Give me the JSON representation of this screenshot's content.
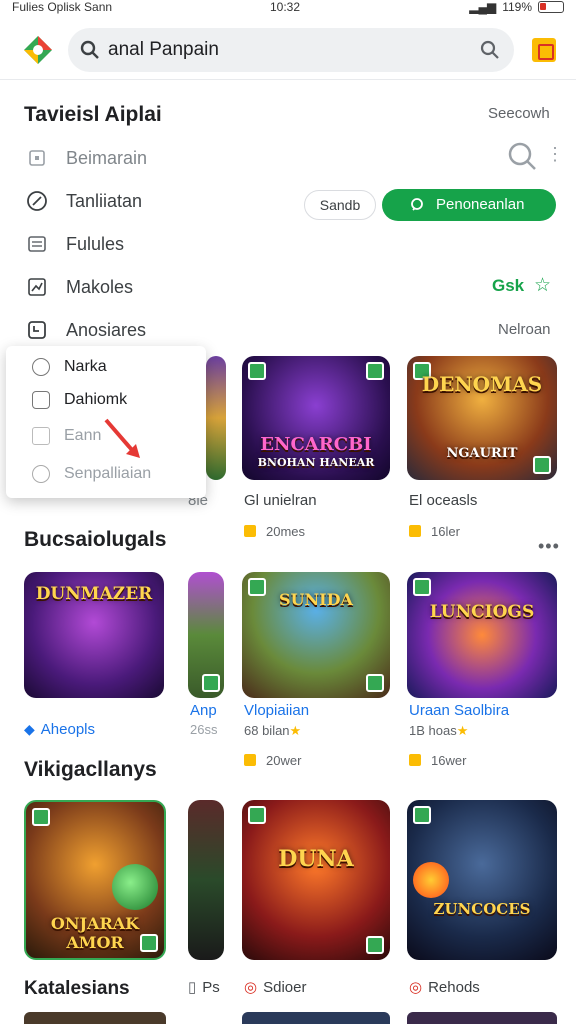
{
  "status": {
    "left": "Fulies Oplisk Sann",
    "time": "10:32",
    "battery": "119%"
  },
  "search": {
    "value": "anal Panpain"
  },
  "section1": {
    "title": "Tavieisl Aiplai",
    "see_more": "Seecowh"
  },
  "menu": [
    {
      "label": "Beimarain",
      "icon": "bookmark-icon"
    },
    {
      "label": "Tanliiatan",
      "icon": "compass-icon"
    },
    {
      "label": "Fulules",
      "icon": "grid-icon"
    },
    {
      "label": "Makoles",
      "icon": "chart-icon"
    },
    {
      "label": "Anosiares",
      "icon": "clock-icon"
    }
  ],
  "chips": {
    "outline": "Sandb",
    "green": "Penoneanlan"
  },
  "rating_text": "Gsk",
  "nelroan": "Nelroan",
  "popup": [
    {
      "label": "Narka"
    },
    {
      "label": "Dahiomk"
    },
    {
      "label": "Eann"
    },
    {
      "label": "Senpalliaian"
    }
  ],
  "row1": {
    "partial_label": "8le",
    "cards": [
      {
        "art_title": "ENCARCBI",
        "art_sub": "BNOHAN HANEAR",
        "label": "Gl unielran",
        "sub": "20mes"
      },
      {
        "art_title": "DENOMAS",
        "art_sub": "NGAURIT",
        "label": "El oceasls",
        "sub": "16ler"
      }
    ]
  },
  "section2": {
    "title": "Bucsaiolugals"
  },
  "row2": {
    "cards": [
      {
        "art_title": "DUNMAZER",
        "label": "Aheopls",
        "label_icon": "verified-icon"
      },
      {
        "art_title": "",
        "label": "Anp",
        "sub_plain": "26ss"
      },
      {
        "art_title": "SUNIDA",
        "label": "Vlopiaiian",
        "sub_plain": "68 bilan",
        "sub": "20wer"
      },
      {
        "art_title": "LUNCIOGS",
        "label": "Uraan Saolbira",
        "sub_plain": "1B hoas",
        "sub": "16wer"
      }
    ]
  },
  "section3": {
    "title": "Vikigacllanys"
  },
  "row3": {
    "cards": [
      {
        "art_title": "ONJARAK AMOR"
      },
      {
        "art_title": ""
      },
      {
        "art_title": "DUNA"
      },
      {
        "art_title": "ZUNCOCES"
      }
    ]
  },
  "section4": {
    "title": "Katalesians",
    "labels": [
      {
        "label": "Ps"
      },
      {
        "label": "Sdioer"
      },
      {
        "label": "Rehods"
      }
    ]
  }
}
